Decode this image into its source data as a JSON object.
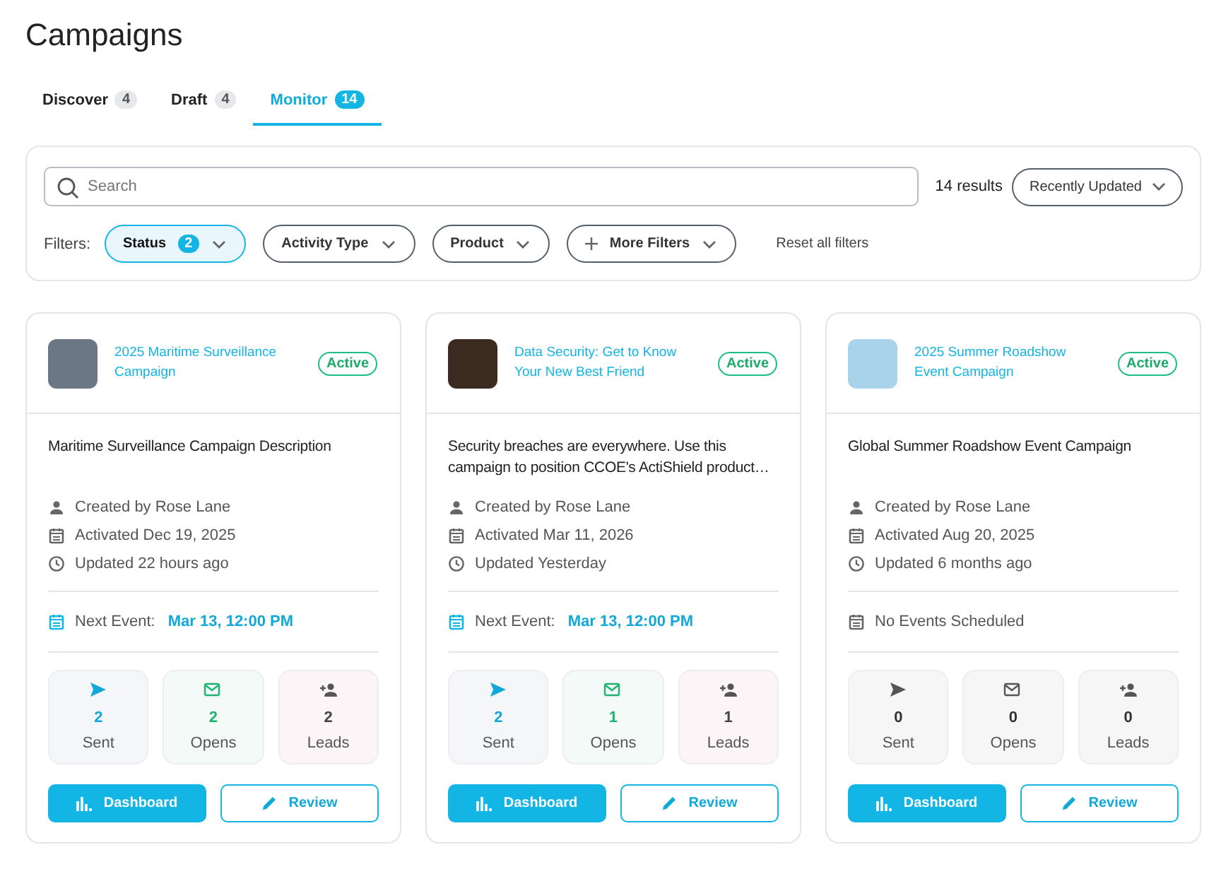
{
  "page": {
    "title": "Campaigns"
  },
  "tabs": [
    {
      "label": "Discover",
      "count": "4",
      "selected": false
    },
    {
      "label": "Draft",
      "count": "4",
      "selected": false
    },
    {
      "label": "Monitor",
      "count": "14",
      "selected": true
    }
  ],
  "search": {
    "placeholder": "Search"
  },
  "results": "14 results",
  "sort": {
    "label": "Recently Updated"
  },
  "filters": {
    "label": "Filters:",
    "items": [
      {
        "label": "Status",
        "count": "2",
        "kind": "dropdown",
        "selected": true
      },
      {
        "label": "Activity Type",
        "kind": "dropdown",
        "selected": false
      },
      {
        "label": "Product",
        "kind": "dropdown",
        "selected": false
      },
      {
        "label": "More Filters",
        "kind": "more",
        "selected": false
      }
    ],
    "reset": "Reset all filters"
  },
  "cards": [
    {
      "title": "2025 Maritime Surveillance Campaign",
      "status": "Active",
      "description": "Maritime Surveillance Campaign Description",
      "created": "Created by Rose Lane",
      "activated": "Activated Dec 19, 2025",
      "updated": "Updated 22 hours ago",
      "event": {
        "scheduled": true,
        "label": "Next Event:",
        "date": "Mar 13, 12:00 PM"
      },
      "stats": [
        {
          "kind": "sent",
          "value": "2",
          "label": "Sent",
          "highlighted": true
        },
        {
          "kind": "opens",
          "value": "2",
          "label": "Opens",
          "highlighted": true
        },
        {
          "kind": "leads",
          "value": "2",
          "label": "Leads",
          "highlighted": true
        }
      ],
      "buttons": [
        "Dashboard",
        "Review"
      ]
    },
    {
      "title": "Data Security: Get to Know Your New Best Friend",
      "status": "Active",
      "description": "Security breaches are everywhere. Use this campaign to position CCOE's ActiShield product…",
      "created": "Created by Rose Lane",
      "activated": "Activated Mar 11, 2026",
      "updated": "Updated Yesterday",
      "event": {
        "scheduled": true,
        "label": "Next Event:",
        "date": "Mar 13, 12:00 PM"
      },
      "stats": [
        {
          "kind": "sent",
          "value": "2",
          "label": "Sent",
          "highlighted": true
        },
        {
          "kind": "opens",
          "value": "1",
          "label": "Opens",
          "highlighted": true
        },
        {
          "kind": "leads",
          "value": "1",
          "label": "Leads",
          "highlighted": true
        }
      ],
      "buttons": [
        "Dashboard",
        "Review"
      ]
    },
    {
      "title": "2025 Summer Roadshow Event Campaign",
      "status": "Active",
      "description": "Global Summer Roadshow Event Campaign",
      "created": "Created by Rose Lane",
      "activated": "Activated Aug 20, 2025",
      "updated": "Updated 6 months ago",
      "event": {
        "scheduled": false,
        "label": "No Events Scheduled"
      },
      "stats": [
        {
          "kind": "sent",
          "value": "0",
          "label": "Sent",
          "highlighted": false
        },
        {
          "kind": "opens",
          "value": "0",
          "label": "Opens",
          "highlighted": false
        },
        {
          "kind": "leads",
          "value": "0",
          "label": "Leads",
          "highlighted": false
        }
      ],
      "buttons": [
        "Dashboard",
        "Review"
      ]
    }
  ]
}
